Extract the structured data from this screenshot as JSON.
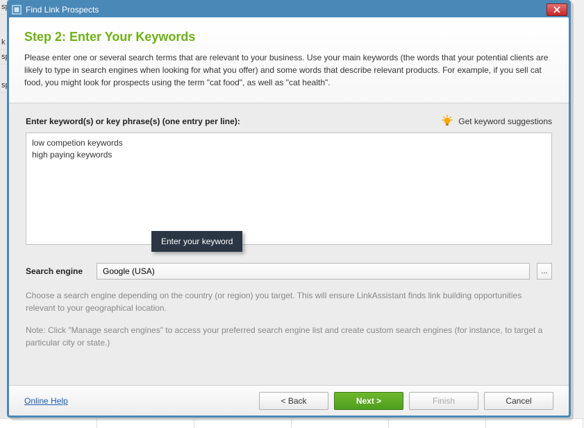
{
  "bg": {
    "side1": "spe",
    "side2": "k fo",
    "side3": "spe",
    "side4": "spe"
  },
  "titlebar": {
    "title": "Find Link Prospects"
  },
  "header": {
    "title": "Step 2: Enter Your Keywords",
    "desc": "Please enter one or several search terms that are relevant to your business. Use your main keywords (the words that your potential clients are likely to type in search engines when looking for what you offer) and some words that describe relevant products. For example, if you sell cat food, you might look for prospects using the term \"cat food\", as well as \"cat health\"."
  },
  "content": {
    "keywords_label": "Enter keyword(s) or key phrase(s) (one entry per line):",
    "suggestions_label": "Get keyword suggestions",
    "keywords_value": "low competion keywords\nhigh paying keywords",
    "tooltip": "Enter your keyword",
    "engine_label": "Search engine",
    "engine_value": "Google (USA)",
    "engine_more": "...",
    "engine_desc": "Choose a search engine depending on the country (or region) you target. This will ensure LinkAssistant finds link building opportunities relevant to your geographical location.",
    "engine_note": "Note: Click \"Manage search engines\" to access your preferred search engine list and create custom search engines (for instance, to target a particular city or state.)"
  },
  "footer": {
    "help": "Online Help",
    "back": "< Back",
    "next": "Next >",
    "finish": "Finish",
    "cancel": "Cancel"
  }
}
